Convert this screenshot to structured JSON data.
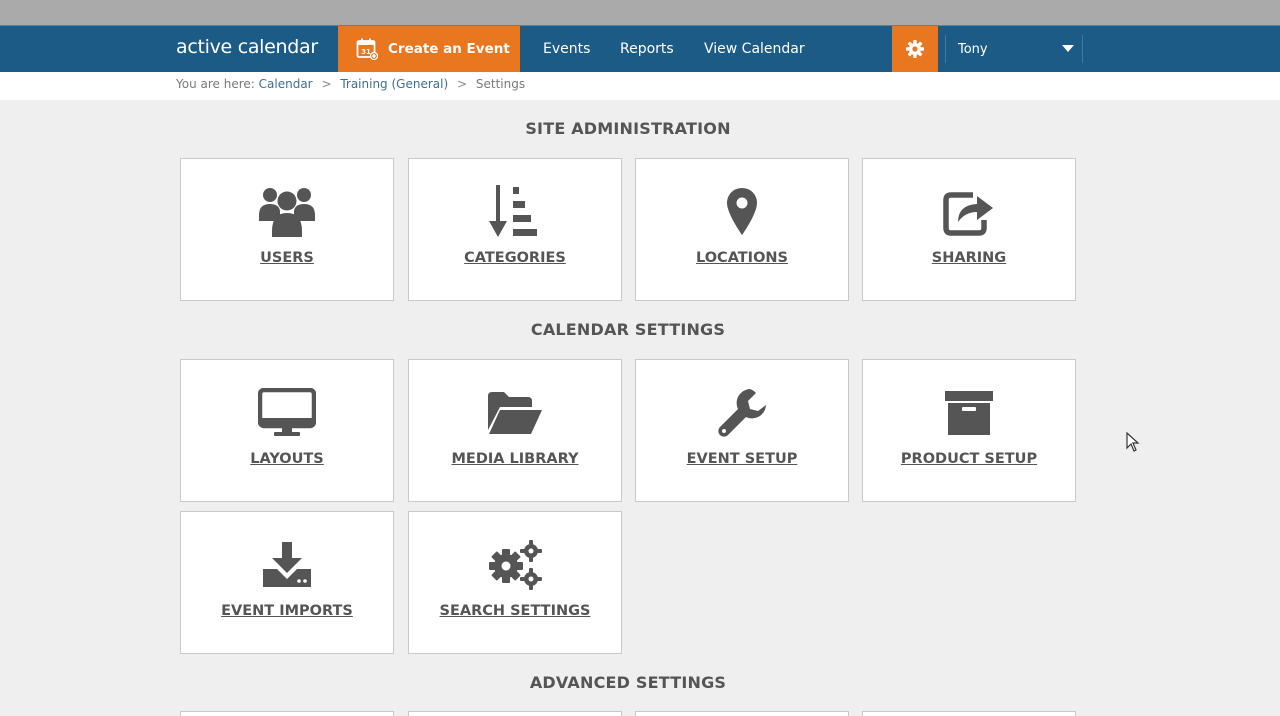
{
  "app": {
    "logo_text": "active calendar",
    "create_event_label": "Create an Event",
    "nav": [
      "Events",
      "Reports",
      "View Calendar"
    ],
    "user_name": "Tony",
    "brand_color": "#1c5b85",
    "accent_color": "#e8771f"
  },
  "breadcrumb": {
    "prefix": "You are here:",
    "items": [
      "Calendar",
      "Training (General)",
      "Settings"
    ],
    "separator": ">"
  },
  "sections": {
    "site_admin": {
      "title": "SITE ADMINISTRATION",
      "tiles": [
        {
          "label": "USERS",
          "icon": "users-icon"
        },
        {
          "label": "CATEGORIES",
          "icon": "sort-list-icon"
        },
        {
          "label": "LOCATIONS",
          "icon": "map-pin-icon"
        },
        {
          "label": "SHARING",
          "icon": "share-icon"
        }
      ]
    },
    "calendar_settings": {
      "title": "CALENDAR SETTINGS",
      "tiles": [
        {
          "label": "LAYOUTS",
          "icon": "monitor-icon"
        },
        {
          "label": "MEDIA LIBRARY",
          "icon": "folder-open-icon"
        },
        {
          "label": "EVENT SETUP",
          "icon": "wrench-icon"
        },
        {
          "label": "PRODUCT SETUP",
          "icon": "archive-box-icon"
        },
        {
          "label": "EVENT IMPORTS",
          "icon": "download-icon"
        },
        {
          "label": "SEARCH SETTINGS",
          "icon": "gears-icon"
        }
      ]
    },
    "advanced_settings": {
      "title": "ADVANCED SETTINGS"
    }
  }
}
